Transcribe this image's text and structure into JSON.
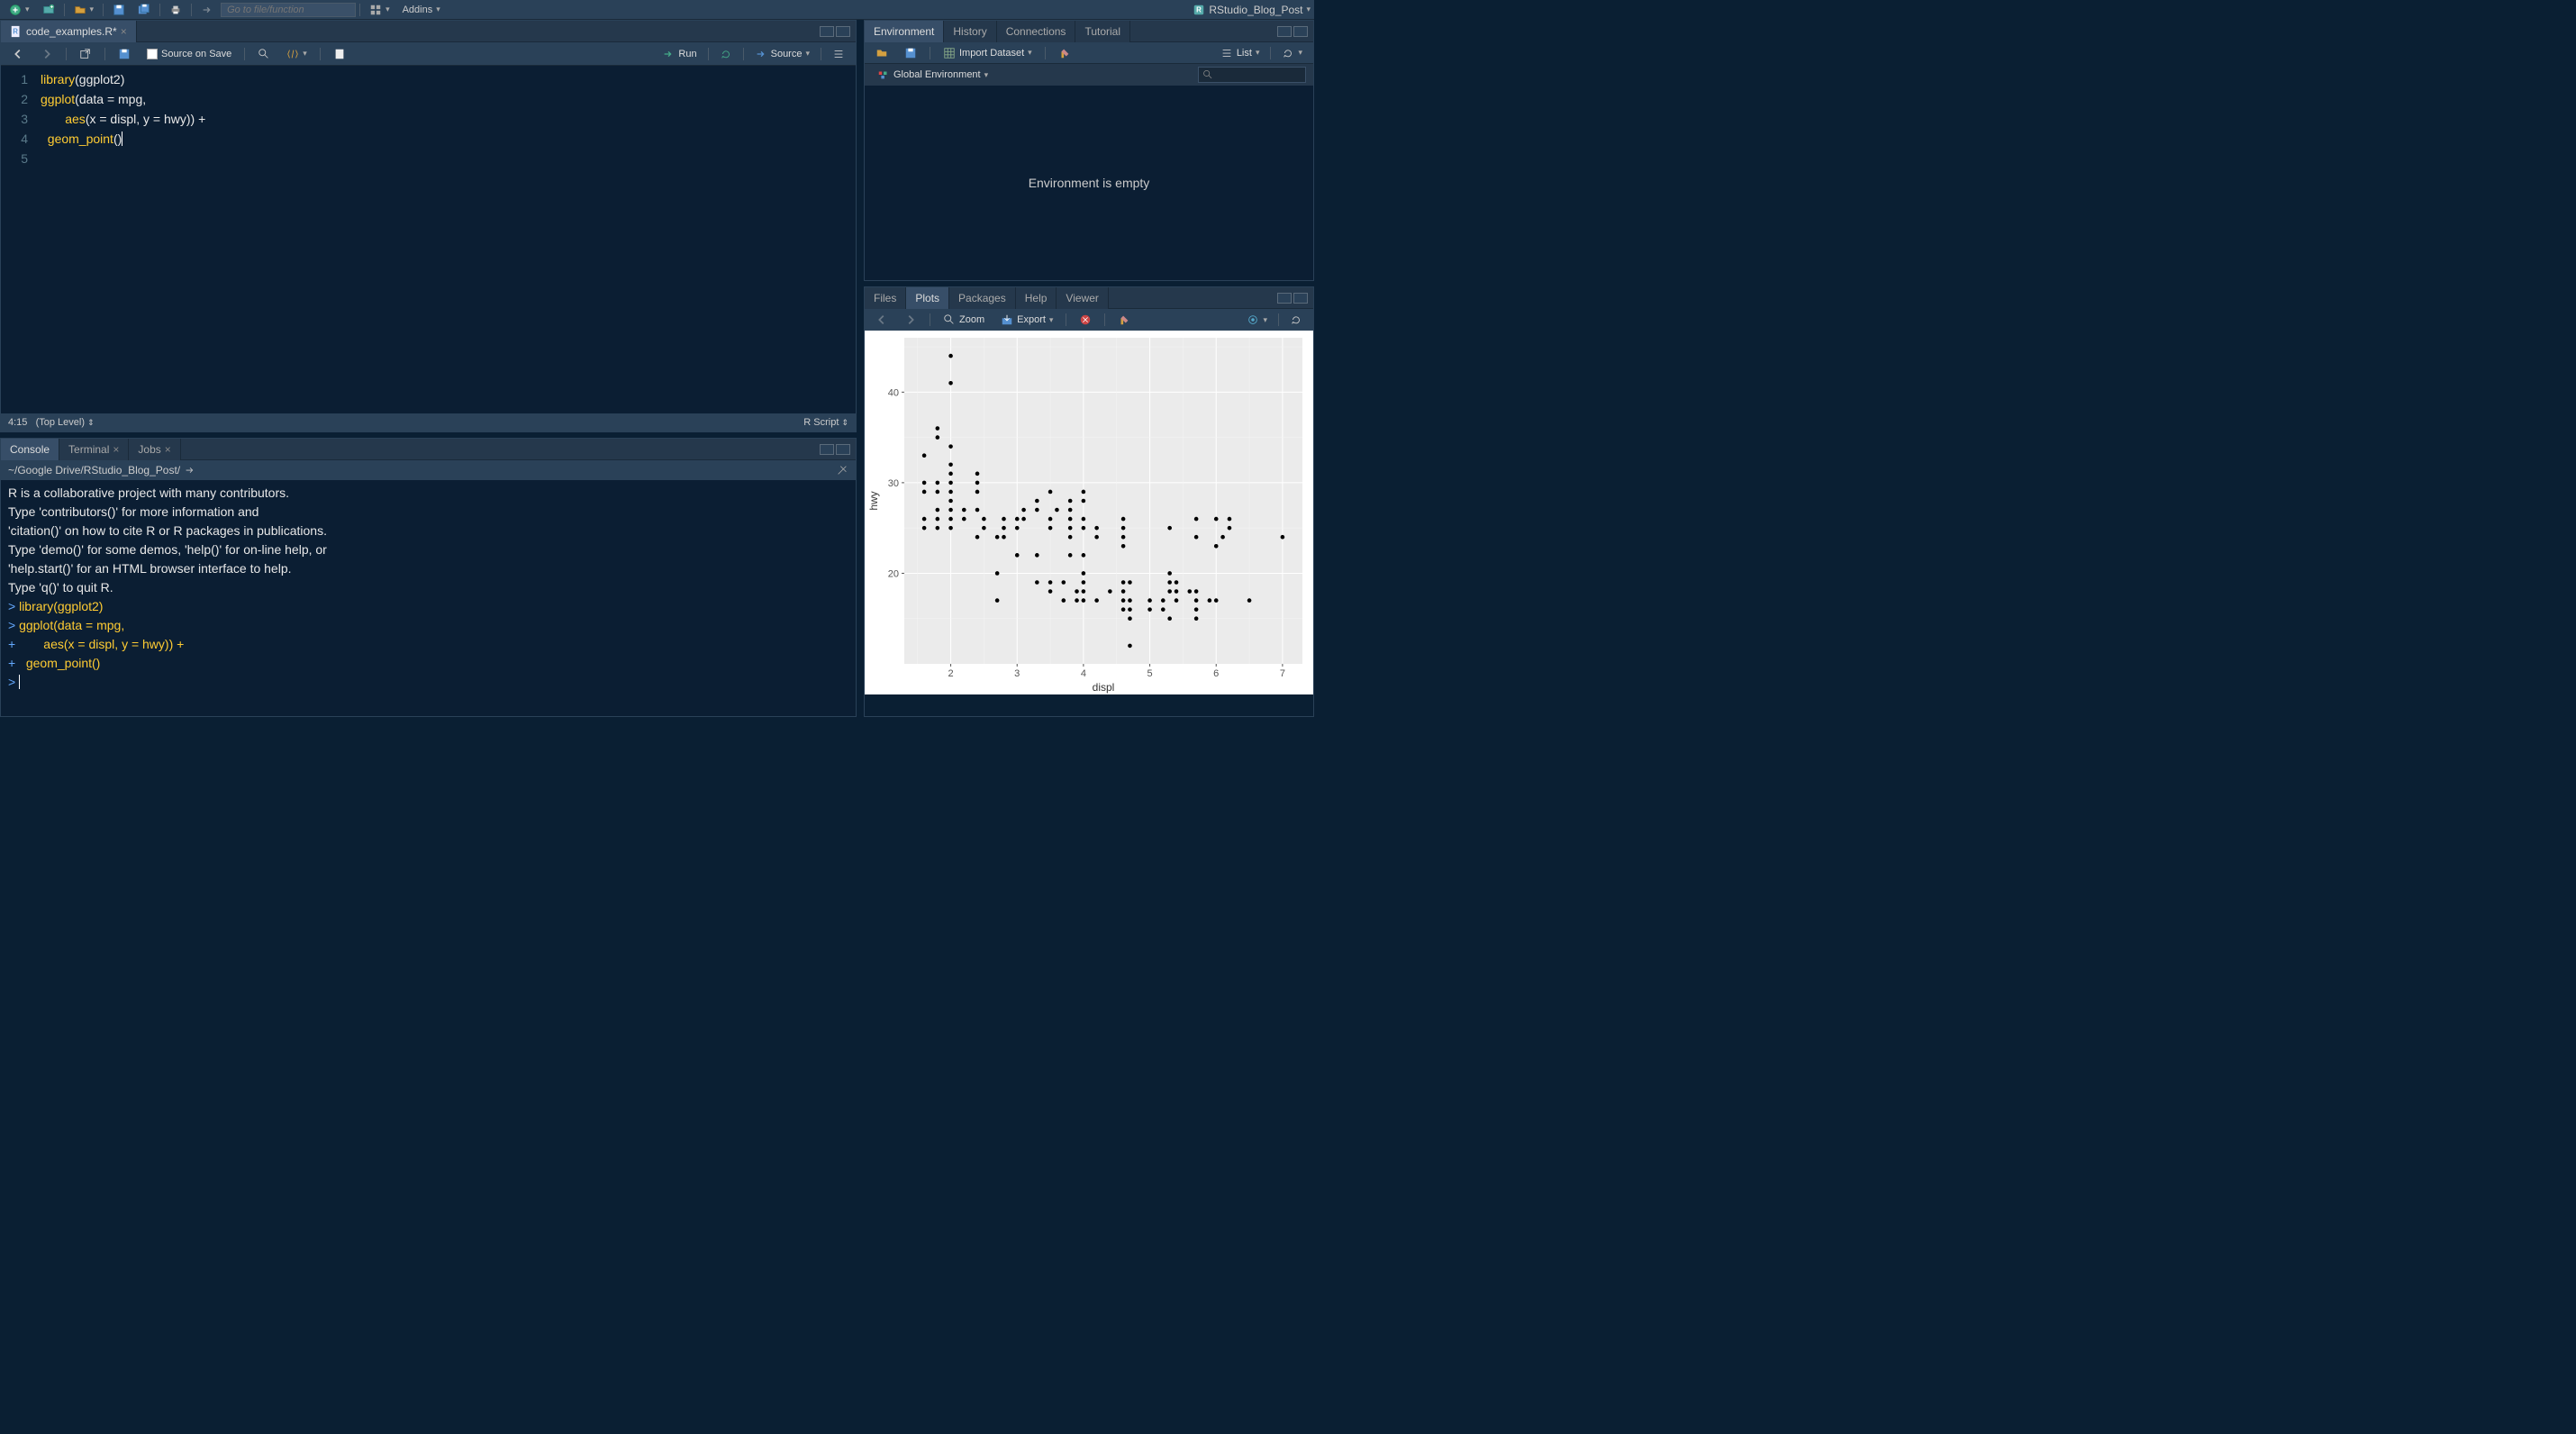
{
  "toolbar": {
    "goto_placeholder": "Go to file/function",
    "addins": "Addins"
  },
  "project_name": "RStudio_Blog_Post",
  "source": {
    "tab_name": "code_examples.R*",
    "source_on_save": "Source on Save",
    "run": "Run",
    "source_btn": "Source",
    "lines": [
      "1",
      "2",
      "3",
      "4",
      "5"
    ],
    "code_tokens": {
      "l1_fn": "library",
      "l1_rest": "(ggplot2)",
      "l2_fn": "ggplot",
      "l2_rest": "(data = mpg,",
      "l3_indent": "       ",
      "l3_fn": "aes",
      "l3_rest": "(x = displ, y = hwy)) +",
      "l4_indent": "  ",
      "l4_fn": "geom_point",
      "l4_rest": "()"
    },
    "status_pos": "4:15",
    "status_scope": "(Top Level)",
    "status_lang": "R Script"
  },
  "console": {
    "tabs": [
      "Console",
      "Terminal",
      "Jobs"
    ],
    "path": "~/Google Drive/RStudio_Blog_Post/",
    "lines": [
      "R is a collaborative project with many contributors.",
      "Type 'contributors()' for more information and",
      "'citation()' on how to cite R or R packages in publications.",
      "",
      "Type 'demo()' for some demos, 'help()' for on-line help, or",
      "'help.start()' for an HTML browser interface to help.",
      "Type 'q()' to quit R.",
      ""
    ],
    "input_lines": [
      {
        "prompt": "> ",
        "text": "library(ggplot2)"
      },
      {
        "prompt": "> ",
        "text": "ggplot(data = mpg,"
      },
      {
        "prompt": "+ ",
        "text": "       aes(x = displ, y = hwy)) +"
      },
      {
        "prompt": "+ ",
        "text": "  geom_point()"
      },
      {
        "prompt": "> ",
        "text": ""
      }
    ]
  },
  "env": {
    "tabs": [
      "Environment",
      "History",
      "Connections",
      "Tutorial"
    ],
    "import": "Import Dataset",
    "list": "List",
    "scope": "Global Environment",
    "empty": "Environment is empty"
  },
  "topright_height": 290,
  "bottomright": {
    "tabs": [
      "Files",
      "Plots",
      "Packages",
      "Help",
      "Viewer"
    ],
    "zoom": "Zoom",
    "export": "Export"
  },
  "chart_data": {
    "type": "scatter",
    "xlabel": "displ",
    "ylabel": "hwy",
    "xlim": [
      1.3,
      7.3
    ],
    "ylim": [
      10,
      46
    ],
    "xticks": [
      2,
      3,
      4,
      5,
      6,
      7
    ],
    "yticks": [
      20,
      30,
      40
    ],
    "points": [
      [
        1.6,
        33
      ],
      [
        1.6,
        30
      ],
      [
        1.6,
        29
      ],
      [
        1.6,
        26
      ],
      [
        1.6,
        25
      ],
      [
        1.8,
        36
      ],
      [
        1.8,
        35
      ],
      [
        1.8,
        30
      ],
      [
        1.8,
        29
      ],
      [
        1.8,
        27
      ],
      [
        1.8,
        26
      ],
      [
        1.8,
        25
      ],
      [
        2.0,
        44
      ],
      [
        2.0,
        41
      ],
      [
        2.0,
        34
      ],
      [
        2.0,
        32
      ],
      [
        2.0,
        31
      ],
      [
        2.0,
        30
      ],
      [
        2.0,
        29
      ],
      [
        2.0,
        28
      ],
      [
        2.0,
        27
      ],
      [
        2.0,
        26
      ],
      [
        2.0,
        25
      ],
      [
        2.2,
        27
      ],
      [
        2.2,
        26
      ],
      [
        2.4,
        31
      ],
      [
        2.4,
        30
      ],
      [
        2.4,
        29
      ],
      [
        2.4,
        27
      ],
      [
        2.4,
        24
      ],
      [
        2.5,
        26
      ],
      [
        2.5,
        25
      ],
      [
        2.7,
        24
      ],
      [
        2.7,
        20
      ],
      [
        2.7,
        17
      ],
      [
        2.8,
        26
      ],
      [
        2.8,
        25
      ],
      [
        2.8,
        24
      ],
      [
        3.0,
        26
      ],
      [
        3.0,
        25
      ],
      [
        3.0,
        22
      ],
      [
        3.1,
        27
      ],
      [
        3.1,
        26
      ],
      [
        3.3,
        28
      ],
      [
        3.3,
        27
      ],
      [
        3.3,
        22
      ],
      [
        3.3,
        19
      ],
      [
        3.5,
        29
      ],
      [
        3.5,
        26
      ],
      [
        3.5,
        25
      ],
      [
        3.5,
        19
      ],
      [
        3.5,
        18
      ],
      [
        3.6,
        27
      ],
      [
        3.7,
        19
      ],
      [
        3.7,
        17
      ],
      [
        3.8,
        28
      ],
      [
        3.8,
        27
      ],
      [
        3.8,
        26
      ],
      [
        3.8,
        25
      ],
      [
        3.8,
        24
      ],
      [
        3.8,
        22
      ],
      [
        3.9,
        18
      ],
      [
        3.9,
        17
      ],
      [
        4.0,
        29
      ],
      [
        4.0,
        28
      ],
      [
        4.0,
        26
      ],
      [
        4.0,
        25
      ],
      [
        4.0,
        22
      ],
      [
        4.0,
        20
      ],
      [
        4.0,
        19
      ],
      [
        4.0,
        18
      ],
      [
        4.0,
        17
      ],
      [
        4.2,
        25
      ],
      [
        4.2,
        24
      ],
      [
        4.2,
        17
      ],
      [
        4.4,
        18
      ],
      [
        4.6,
        26
      ],
      [
        4.6,
        25
      ],
      [
        4.6,
        24
      ],
      [
        4.6,
        23
      ],
      [
        4.6,
        19
      ],
      [
        4.6,
        18
      ],
      [
        4.6,
        17
      ],
      [
        4.6,
        16
      ],
      [
        4.7,
        19
      ],
      [
        4.7,
        17
      ],
      [
        4.7,
        16
      ],
      [
        4.7,
        15
      ],
      [
        4.7,
        12
      ],
      [
        5.0,
        17
      ],
      [
        5.0,
        16
      ],
      [
        5.2,
        17
      ],
      [
        5.2,
        16
      ],
      [
        5.3,
        25
      ],
      [
        5.3,
        20
      ],
      [
        5.3,
        19
      ],
      [
        5.3,
        18
      ],
      [
        5.3,
        15
      ],
      [
        5.4,
        19
      ],
      [
        5.4,
        18
      ],
      [
        5.4,
        17
      ],
      [
        5.6,
        18
      ],
      [
        5.7,
        26
      ],
      [
        5.7,
        24
      ],
      [
        5.7,
        18
      ],
      [
        5.7,
        17
      ],
      [
        5.7,
        16
      ],
      [
        5.7,
        15
      ],
      [
        5.9,
        17
      ],
      [
        6.0,
        26
      ],
      [
        6.0,
        23
      ],
      [
        6.0,
        17
      ],
      [
        6.1,
        24
      ],
      [
        6.2,
        26
      ],
      [
        6.2,
        25
      ],
      [
        6.5,
        17
      ],
      [
        7.0,
        24
      ]
    ]
  }
}
